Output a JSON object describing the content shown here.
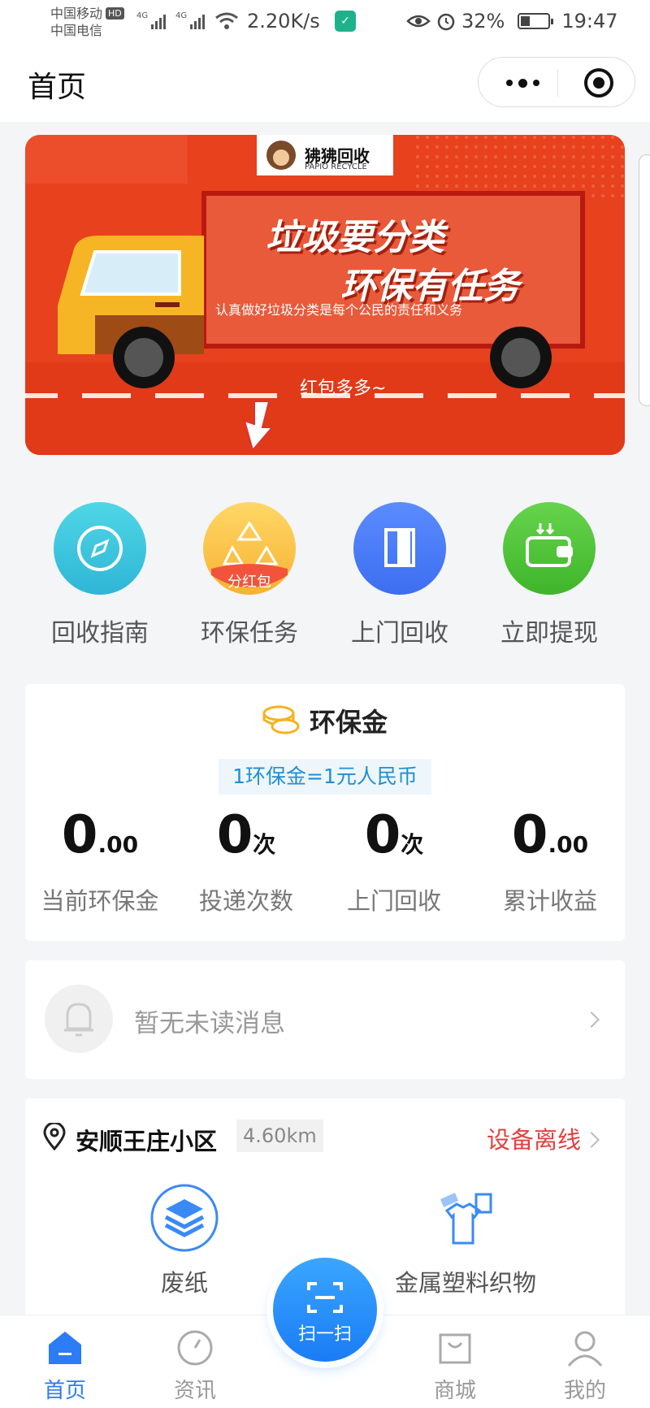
{
  "status_bar": {
    "carrier_1": "中国移动",
    "carrier_1_badge": "HD",
    "carrier_2": "中国电信",
    "network_1": "4G",
    "network_2": "4G",
    "speed": "2.20K/s",
    "battery": "32%",
    "time": "19:47"
  },
  "header": {
    "title": "首页"
  },
  "banner": {
    "brand": "狒狒回收",
    "brand_en": "PAPIO RECYCLE",
    "headline_1": "垃圾要分类",
    "headline_2": "环保有任务",
    "subline": "认真做好垃圾分类是每个公民的责任和义务",
    "cta": "红包多多~",
    "colors": {
      "bg": "#e8411e",
      "board": "#e85a3a",
      "truck": "#f6b524"
    }
  },
  "quick_actions": [
    {
      "label": "回收指南",
      "icon": "compass-icon",
      "color": "#3fc8dc"
    },
    {
      "label": "环保任务",
      "icon": "recycle-icon",
      "badge": "分红包",
      "color": "#fbc74a"
    },
    {
      "label": "上门回收",
      "icon": "door-icon",
      "color": "#4a7ff5"
    },
    {
      "label": "立即提现",
      "icon": "wallet-icon",
      "color": "#4ec43a"
    }
  ],
  "eco_card": {
    "title": "环保金",
    "rate": "1环保金=1元人民币",
    "stats": [
      {
        "value": "0",
        "unit": ".00",
        "label": "当前环保金"
      },
      {
        "value": "0",
        "unit": "次",
        "label": "投递次数"
      },
      {
        "value": "0",
        "unit": "次",
        "label": "上门回收"
      },
      {
        "value": "0",
        "unit": ".00",
        "label": "累计收益"
      }
    ]
  },
  "messages": {
    "text": "暂无未读消息"
  },
  "location": {
    "name": "安顺王庄小区",
    "distance": "4.60km",
    "status": "设备离线",
    "bins": [
      {
        "label": "废纸",
        "icon": "paper-layers-icon"
      },
      {
        "label": "金属塑料织物",
        "icon": "clothes-bottle-icon"
      }
    ]
  },
  "scan_button": {
    "label": "扫一扫"
  },
  "tabbar": [
    {
      "label": "首页",
      "icon": "home-icon",
      "active": true
    },
    {
      "label": "资讯",
      "icon": "compass-icon",
      "active": false
    },
    {
      "label": "商城",
      "icon": "shopping-bag-icon",
      "active": false
    },
    {
      "label": "我的",
      "icon": "user-icon",
      "active": false
    }
  ],
  "accent_color": "#2c7cf6"
}
